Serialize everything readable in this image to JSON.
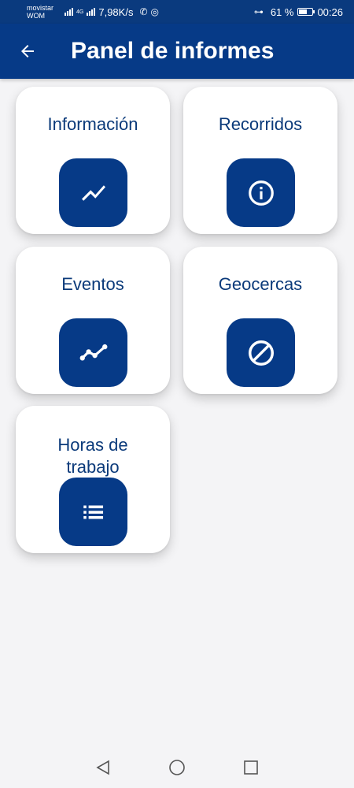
{
  "status_bar": {
    "carrier_line1": "movistar",
    "carrier_line2": "WOM",
    "network": "4G",
    "speed": "7,98K/s",
    "battery_percent": "61 %",
    "battery_level": 0.61,
    "time": "00:26",
    "icons": [
      "signal-icon",
      "call-icon",
      "whatsapp-icon",
      "key-icon",
      "battery-icon"
    ]
  },
  "app_bar": {
    "title": "Panel de informes",
    "back_icon": "arrow-left-icon",
    "color": "#063a87"
  },
  "cards": [
    {
      "label": "Información",
      "icon": "trending-up-icon"
    },
    {
      "label": "Recorridos",
      "icon": "info-circle-icon"
    },
    {
      "label": "Eventos",
      "icon": "timeline-icon"
    },
    {
      "label": "Geocercas",
      "icon": "block-icon"
    },
    {
      "label": "Horas de trabajo",
      "icon": "list-icon"
    }
  ],
  "nav_bar": {
    "icons": [
      "back-triangle-icon",
      "home-circle-icon",
      "recents-square-icon"
    ]
  },
  "colors": {
    "primary": "#063a87",
    "text_primary": "#0b3a7a",
    "background": "#f4f4f6",
    "card": "#ffffff"
  }
}
